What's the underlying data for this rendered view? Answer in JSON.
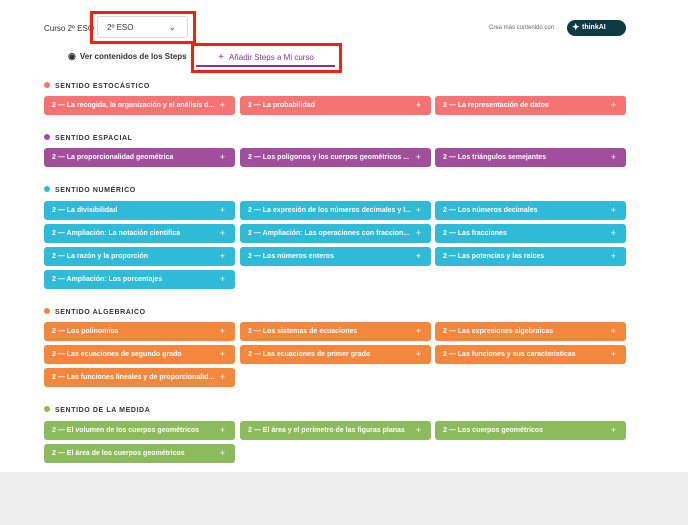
{
  "header": {
    "course_label": "Curso 2º ESO",
    "course_value": "2º ESO",
    "crea_text": "Crea más contenido con",
    "brand_text": "thinkAI"
  },
  "tabs": {
    "view_label": "Ver contenidos de los Steps",
    "add_label": "Añadir Steps a Mi curso"
  },
  "colors": {
    "estocastico": "#f47474",
    "espacial": "#a14f9d",
    "numerico": "#2fbad8",
    "algebraico": "#f2873d",
    "medida": "#8bbb5b",
    "highlight": "#ee2211"
  },
  "sections": [
    {
      "title": "SENTIDO ESTOCÁSTICO",
      "items": [
        "2 — La recogida, la organización y el análisis d...",
        "2 — La probabilidad",
        "2 — La representación de datos"
      ]
    },
    {
      "title": "SENTIDO ESPACIAL",
      "items": [
        "2 — La proporcionalidad geométrica",
        "2 — Los polígonos y los cuerpos geométricos ...",
        "2 — Los triángulos semejantes"
      ]
    },
    {
      "title": "SENTIDO NUMÉRICO",
      "items": [
        "2 — La divisibilidad",
        "2 — La expresión de los números decimales y l...",
        "2 — Los números decimales",
        "2 — Ampliación: La notación científica",
        "2 — Ampliación: Las operaciones con fraccion...",
        "2 — Las fracciones",
        "2 — La razón y la proporción",
        "2 — Los números enteros",
        "2 — Las potencias y las raíces",
        "2 — Ampliación: Los porcentajes"
      ]
    },
    {
      "title": "SENTIDO ALGEBRAICO",
      "items": [
        "2 — Los polinomios",
        "2 — Los sistemas de ecuaciones",
        "2 — Las expresiones algebraicas",
        "2 — Las ecuaciones de segundo grado",
        "2 — Las ecuaciones de primer grado",
        "2 — Las funciones y sus características",
        "2 — Las funciones lineales y de proporcionalid..."
      ]
    },
    {
      "title": "SENTIDO DE LA MEDIDA",
      "items": [
        "2 — El volumen de los cuerpos geométricos",
        "2 — El área y el perímetro de las figuras planas",
        "2 — Los cuerpos geométricos",
        "2 — El área de los cuerpos geométricos"
      ]
    }
  ]
}
